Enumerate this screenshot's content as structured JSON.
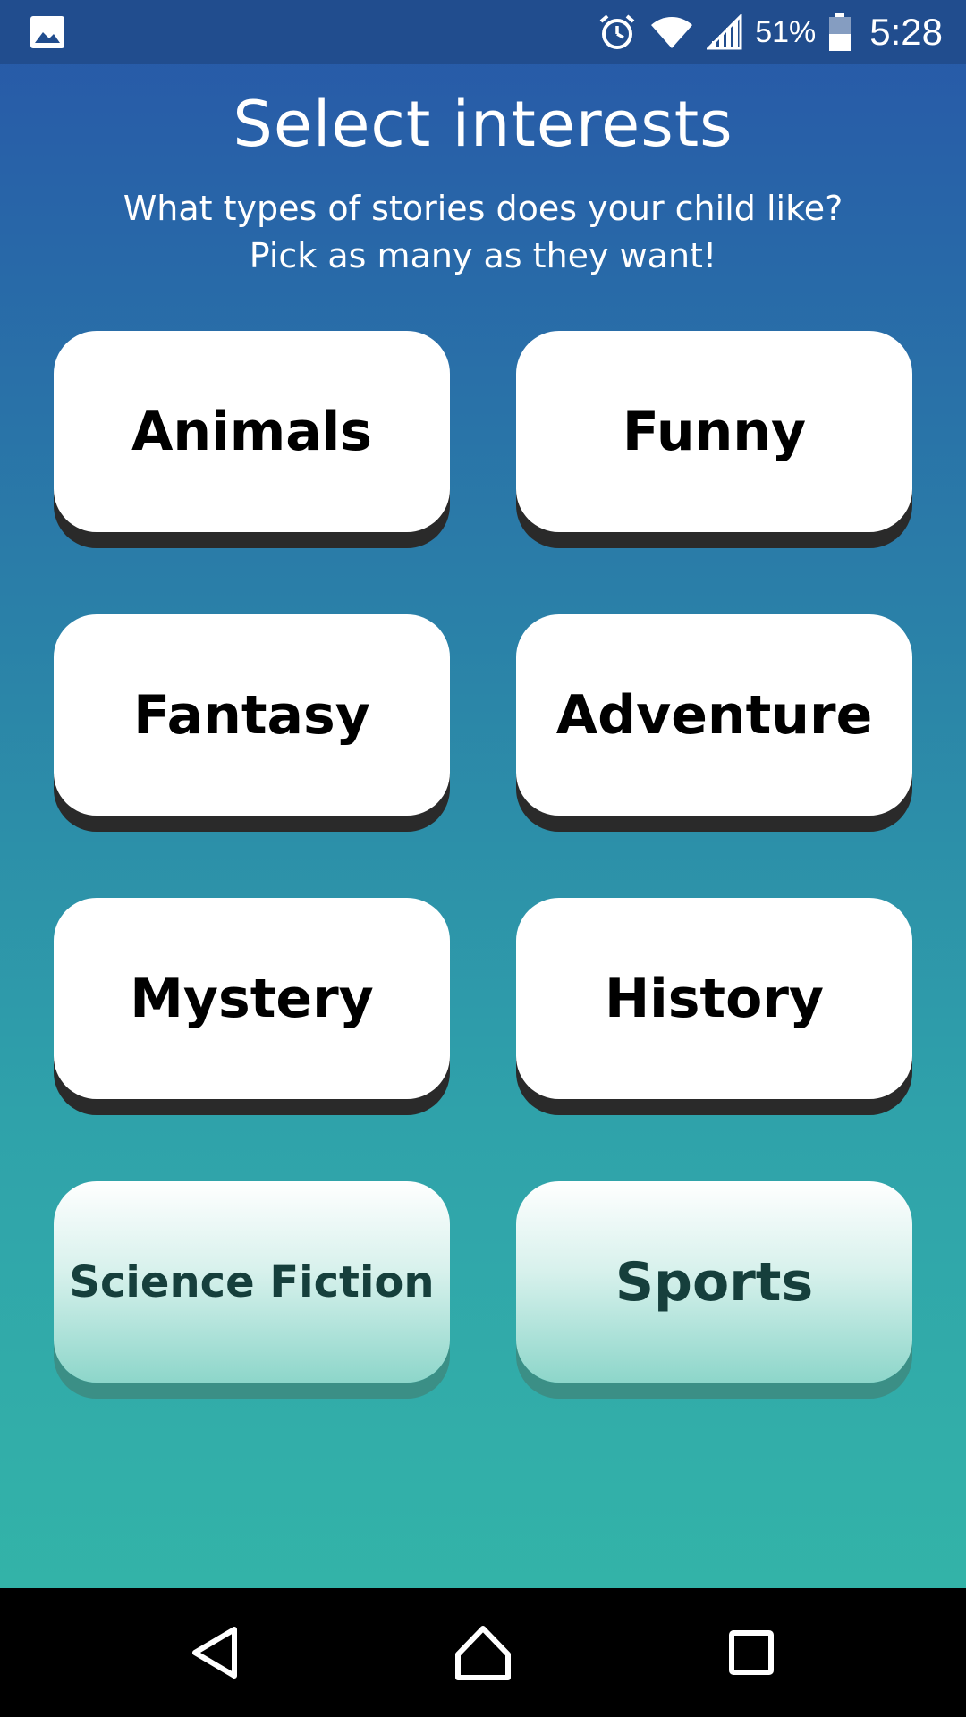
{
  "status_bar": {
    "left_icon": "image-icon",
    "icons": [
      "alarm-icon",
      "wifi-icon",
      "signal-icon",
      "battery-icon"
    ],
    "battery_percent": "51%",
    "time": "5:28"
  },
  "header": {
    "title": "Select interests",
    "subtitle_line1": "What types of stories does your child like?",
    "subtitle_line2": "Pick as many as they want!"
  },
  "interests": [
    {
      "label": "Animals",
      "selected": false
    },
    {
      "label": "Funny",
      "selected": false
    },
    {
      "label": "Fantasy",
      "selected": false
    },
    {
      "label": "Adventure",
      "selected": false
    },
    {
      "label": "Mystery",
      "selected": false
    },
    {
      "label": "History",
      "selected": false
    },
    {
      "label": "Science Fiction",
      "selected": true
    },
    {
      "label": "Sports",
      "selected": true
    }
  ],
  "nav_bar": {
    "buttons": [
      "back-icon",
      "home-icon",
      "recents-icon"
    ]
  },
  "colors": {
    "status_bar": "#214d8e",
    "gradient_top": "#2757a8",
    "gradient_bottom": "#34b8a8",
    "button_bg": "#ffffff",
    "selected_text": "#163f3c"
  }
}
